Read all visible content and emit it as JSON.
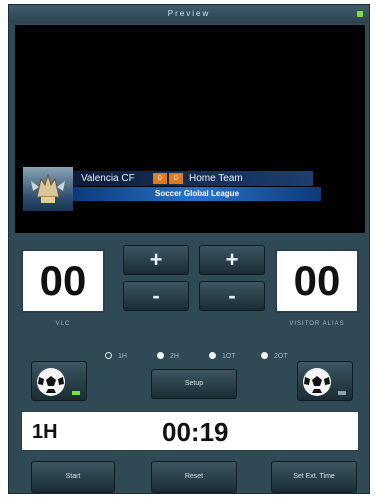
{
  "window": {
    "title": "Preview"
  },
  "preview": {
    "home_team": "Valencia CF",
    "home_score": "0",
    "away_score": "0",
    "away_team": "Home Team",
    "league": "Soccer Global League"
  },
  "scoreboard": {
    "home_score": "00",
    "away_score": "00",
    "home_label": "VLC",
    "away_label": "VISITOR ALIAS",
    "plus": "+",
    "minus": "-"
  },
  "periods": [
    {
      "label": "1H",
      "selected": true
    },
    {
      "label": "2H",
      "selected": false
    },
    {
      "label": "1OT",
      "selected": false
    },
    {
      "label": "2OT",
      "selected": false
    }
  ],
  "buttons": {
    "setup": "Setup",
    "start": "Start",
    "reset": "Reset",
    "set_time": "Set Ext. Time"
  },
  "clock": {
    "period": "1H",
    "time": "00:19"
  },
  "colors": {
    "panel": "#2f4a55",
    "accent_orange": "#e07a1f",
    "league_bar": "#2a73c9",
    "indicator_green": "#7fdc44"
  },
  "icons": {
    "home_ball": "soccer-ball-icon",
    "away_ball": "soccer-ball-icon",
    "logo": "bat-crest-logo"
  }
}
